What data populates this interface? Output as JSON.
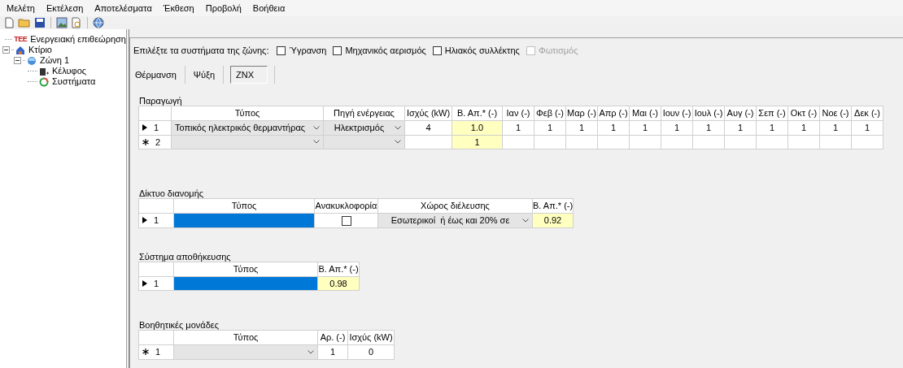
{
  "menu": [
    "Μελέτη",
    "Εκτέλεση",
    "Αποτελέσματα",
    "Έκθεση",
    "Προβολή",
    "Βοήθεια"
  ],
  "tree": [
    {
      "kind": "root",
      "logo": "ΤΕΕ",
      "label": "Ενεργειακή επιθεώρηση"
    },
    {
      "kind": "building",
      "label": "Κτίριο",
      "expanded": true,
      "children": [
        {
          "kind": "zone",
          "label": "Ζώνη 1",
          "expanded": true,
          "children": [
            {
              "kind": "envelope",
              "label": "Κέλυφος"
            },
            {
              "kind": "systems",
              "label": "Συστήματα"
            }
          ]
        }
      ]
    }
  ],
  "prompt": "Επιλέξτε τα συστήματα της ζώνης:",
  "systems": [
    {
      "label": "Ύγρανση",
      "checked": false,
      "disabled": false
    },
    {
      "label": "Μηχανικός αερισμός",
      "checked": false,
      "disabled": false
    },
    {
      "label": "Ηλιακός συλλέκτης",
      "checked": false,
      "disabled": false
    },
    {
      "label": "Φωτισμός",
      "checked": false,
      "disabled": true
    }
  ],
  "tabs": [
    {
      "label": "Θέρμανση",
      "selected": false
    },
    {
      "label": "Ψύξη",
      "selected": false
    },
    {
      "label": "ZNX",
      "selected": true
    }
  ],
  "tables": [
    {
      "title": "Παραγωγή",
      "columns": [
        "Τύπος",
        "Πηγή ενέργειας",
        "Ισχύς (kW)",
        "Β. Απ.* (-)",
        "Ιαν (-)",
        "Φεβ (-)",
        "Μαρ (-)",
        "Απρ (-)",
        "Μαι (-)",
        "Ιουν (-)",
        "Ιουλ (-)",
        "Αυγ (-)",
        "Σεπ (-)",
        "Οκτ (-)",
        "Νοε (-)",
        "Δεκ (-)"
      ],
      "rows": [
        {
          "kind": "current",
          "number": "1",
          "cells": [
            {
              "kind": "combo",
              "text": "Τοπικός ηλεκτρικός θερμαντήρας"
            },
            {
              "kind": "combo",
              "text": "Ηλεκτρισμός"
            },
            {
              "kind": "plain",
              "text": "4"
            },
            {
              "kind": "required",
              "text": "1.0"
            },
            {
              "kind": "plain",
              "text": "1"
            },
            {
              "kind": "plain",
              "text": "1"
            },
            {
              "kind": "plain",
              "text": "1"
            },
            {
              "kind": "plain",
              "text": "1"
            },
            {
              "kind": "plain",
              "text": "1"
            },
            {
              "kind": "plain",
              "text": "1"
            },
            {
              "kind": "plain",
              "text": "1"
            },
            {
              "kind": "plain",
              "text": "1"
            },
            {
              "kind": "plain",
              "text": "1"
            },
            {
              "kind": "plain",
              "text": "1"
            },
            {
              "kind": "plain",
              "text": "1"
            },
            {
              "kind": "plain",
              "text": "1"
            }
          ]
        },
        {
          "kind": "new",
          "number": "2",
          "cells": [
            {
              "kind": "combo"
            },
            {
              "kind": "combo"
            },
            {
              "kind": "plain"
            },
            {
              "kind": "required",
              "text": "1"
            },
            {
              "kind": "plain"
            },
            {
              "kind": "plain"
            },
            {
              "kind": "plain"
            },
            {
              "kind": "plain"
            },
            {
              "kind": "plain"
            },
            {
              "kind": "plain"
            },
            {
              "kind": "plain"
            },
            {
              "kind": "plain"
            },
            {
              "kind": "plain"
            },
            {
              "kind": "plain"
            },
            {
              "kind": "plain"
            },
            {
              "kind": "plain"
            }
          ]
        }
      ]
    },
    {
      "title": "Δίκτυο διανομής",
      "columns": [
        "Τύπος",
        "Ανακυκλοφορία",
        "Χώρος διέλευσης",
        "Β. Απ.* (-)"
      ],
      "rows": [
        {
          "kind": "current",
          "number": "1",
          "cells": [
            {
              "kind": "selected"
            },
            {
              "kind": "checkbox",
              "checked": false
            },
            {
              "kind": "combo",
              "text": "Εσωτερικοί  ή έως και 20% σε"
            },
            {
              "kind": "required",
              "text": "0.92"
            }
          ]
        }
      ]
    },
    {
      "title": "Σύστημα αποθήκευσης",
      "columns": [
        "Τύπος",
        "Β. Απ.* (-)"
      ],
      "rows": [
        {
          "kind": "current",
          "number": "1",
          "cells": [
            {
              "kind": "selected"
            },
            {
              "kind": "required",
              "text": "0.98"
            }
          ]
        }
      ]
    },
    {
      "title": "Βοηθητικές μονάδες",
      "columns": [
        "Τύπος",
        "Αρ. (-)",
        "Ισχύς (kW)"
      ],
      "rows": [
        {
          "kind": "new",
          "number": "1",
          "cells": [
            {
              "kind": "combo"
            },
            {
              "kind": "plain",
              "text": "1"
            },
            {
              "kind": "plain",
              "text": "0"
            }
          ]
        }
      ]
    }
  ]
}
